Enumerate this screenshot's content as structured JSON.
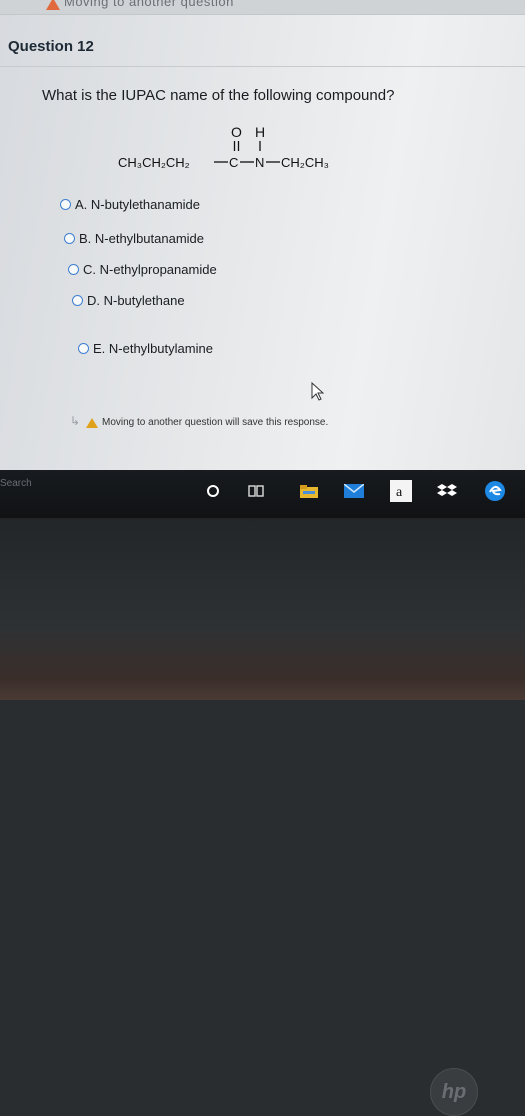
{
  "top_banner": {
    "cut_text": "Moving to another question"
  },
  "question": {
    "title": "Question 12",
    "prompt": "What is the IUPAC name of the following compound?"
  },
  "formula": {
    "left": "CH₃CH₂CH₂",
    "c": "C",
    "n": "N",
    "right": "CH₂CH₃",
    "o": "O",
    "h": "H"
  },
  "options": [
    {
      "label": "A. N-butylethanamide"
    },
    {
      "label": "B. N-ethylbutanamide"
    },
    {
      "label": "C. N-ethylpropanamide"
    },
    {
      "label": "D. N-butylethane"
    },
    {
      "label": "E. N-ethylbutylamine"
    }
  ],
  "notice": {
    "text": "Moving to another question will save this response."
  },
  "taskbar": {
    "search": "Search"
  },
  "icons": [
    "warning-icon",
    "cursor-icon",
    "search-icon",
    "cortana-icon",
    "task-view-icon",
    "file-explorer-icon",
    "mail-icon",
    "amazon-icon",
    "dropbox-icon",
    "edge-icon"
  ],
  "colors": {
    "radio_border": "#3f7fd1",
    "warning": "#e0a21a"
  }
}
